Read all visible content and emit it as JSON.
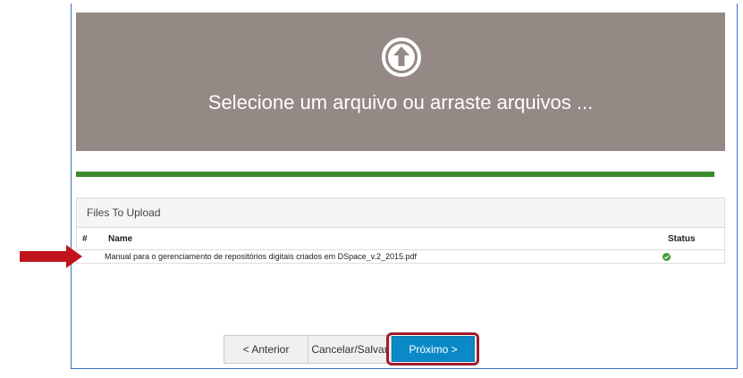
{
  "dropzone": {
    "text": "Selecione um arquivo ou arraste arquivos ...",
    "icon": "upload-circle-icon"
  },
  "progress": {
    "percent": 100,
    "color": "#3c8a2e"
  },
  "files_panel": {
    "heading": "Files To Upload",
    "columns": {
      "index": "#",
      "name": "Name",
      "status": "Status"
    },
    "rows": [
      {
        "name": "Manual para o gerenciamento de repositórios digitais criados em DSpace_v.2_2015.pdf",
        "status_icon": "check-circle-icon"
      }
    ]
  },
  "buttons": {
    "previous": "< Anterior",
    "cancel": "Cancelar/Salvar",
    "next": "Próximo >"
  },
  "colors": {
    "dropzone_bg": "#948985",
    "next_button": "#0b89c6",
    "highlight": "#a31b2b",
    "arrow": "#c0141c",
    "status_ok": "#3c9a3c"
  }
}
